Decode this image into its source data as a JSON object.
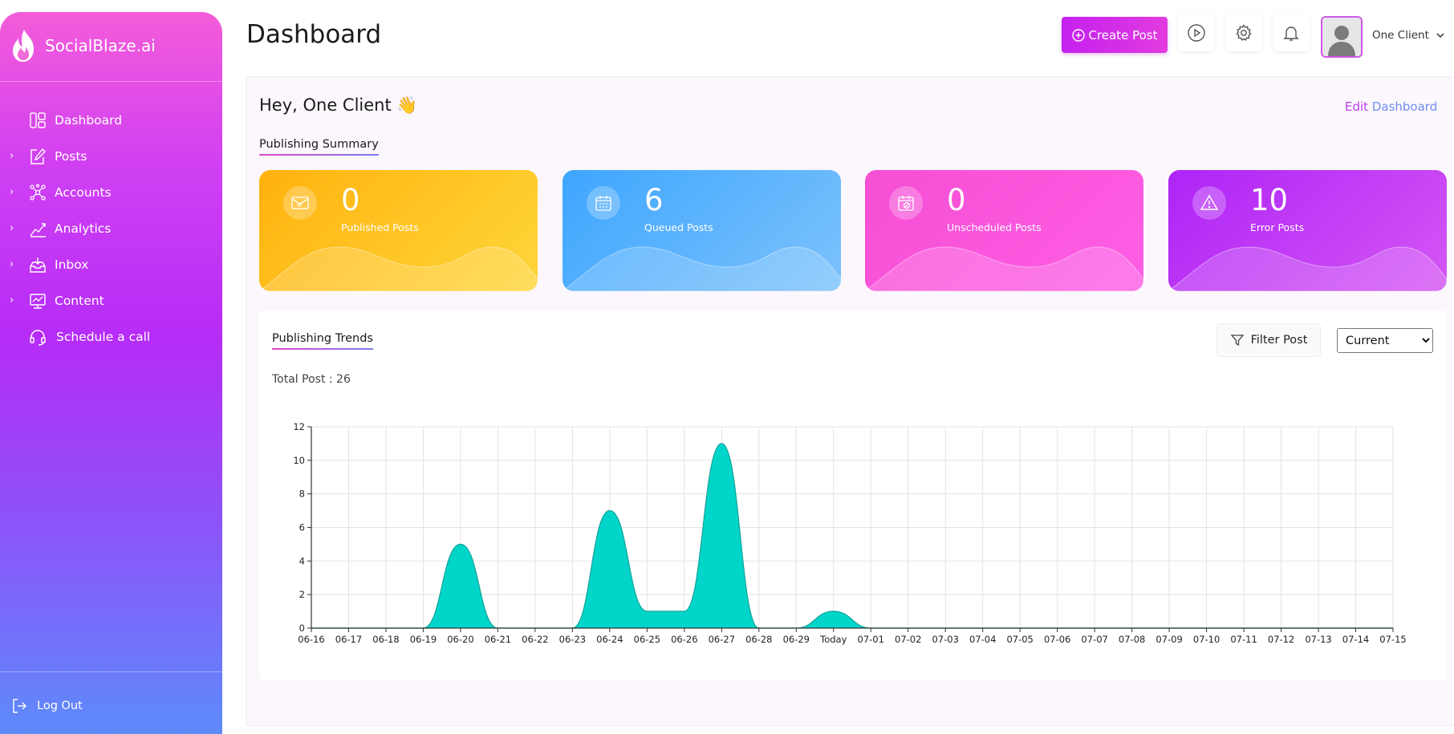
{
  "sidebar": {
    "brand": "SocialBlaze.ai",
    "items": [
      {
        "label": "Dashboard",
        "expandable": false,
        "icon": "dashboard-icon"
      },
      {
        "label": "Posts",
        "expandable": true,
        "icon": "edit-icon"
      },
      {
        "label": "Accounts",
        "expandable": true,
        "icon": "network-icon"
      },
      {
        "label": "Analytics",
        "expandable": true,
        "icon": "analytics-icon"
      },
      {
        "label": "Inbox",
        "expandable": true,
        "icon": "inbox-icon"
      },
      {
        "label": "Content",
        "expandable": true,
        "icon": "content-icon"
      },
      {
        "label": "Schedule a call",
        "expandable": false,
        "icon": "headset-icon"
      }
    ],
    "logout": "Log Out"
  },
  "header": {
    "title": "Dashboard",
    "create_post": "Create Post",
    "user_name": "One Client"
  },
  "main": {
    "greeting": "Hey, One Client 👋",
    "edit_prefix": "Edit",
    "edit_suffix": "Dashboard",
    "summary_title": "Publishing Summary",
    "cards": [
      {
        "value": "0",
        "label": "Published Posts",
        "icon": "published-icon"
      },
      {
        "value": "6",
        "label": "Queued Posts",
        "icon": "calendar-icon"
      },
      {
        "value": "0",
        "label": "Unscheduled Posts",
        "icon": "calendar-blocked-icon"
      },
      {
        "value": "10",
        "label": "Error Posts",
        "icon": "warning-icon"
      }
    ],
    "trends_title": "Publishing Trends",
    "filter_label": "Filter Post",
    "period_selected": "Current",
    "total_post": "Total Post : 26"
  },
  "colors": {
    "accent": "#c521ef",
    "chart_fill": "#00d5c9",
    "chart_stroke": "#14a79e"
  },
  "chart_data": {
    "type": "area",
    "x": [
      "06-16",
      "06-17",
      "06-18",
      "06-19",
      "06-20",
      "06-21",
      "06-22",
      "06-23",
      "06-24",
      "06-25",
      "06-26",
      "06-27",
      "06-28",
      "06-29",
      "Today",
      "07-01",
      "07-02",
      "07-03",
      "07-04",
      "07-05",
      "07-06",
      "07-07",
      "07-08",
      "07-09",
      "07-10",
      "07-11",
      "07-12",
      "07-13",
      "07-14",
      "07-15"
    ],
    "values": [
      0,
      0,
      0,
      0,
      5,
      0,
      0,
      0,
      7,
      1,
      1,
      11,
      0,
      0,
      1,
      0,
      0,
      0,
      0,
      0,
      0,
      0,
      0,
      0,
      0,
      0,
      0,
      0,
      0,
      0
    ],
    "yticks": [
      0,
      2,
      4,
      6,
      8,
      10,
      12
    ],
    "ylim": [
      0,
      12
    ],
    "grid": true,
    "title": "",
    "xlabel": "",
    "ylabel": ""
  }
}
